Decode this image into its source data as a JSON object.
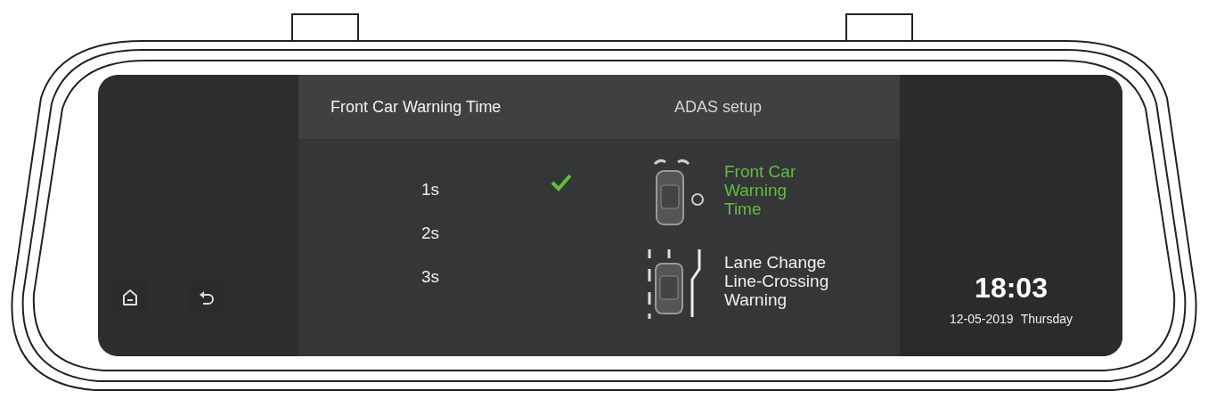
{
  "header": {
    "title": "Front Car Warning Time",
    "section": "ADAS setup"
  },
  "options": [
    {
      "label": "1s",
      "selected": true
    },
    {
      "label": "2s",
      "selected": false
    },
    {
      "label": "3s",
      "selected": false
    }
  ],
  "features": [
    {
      "kind": "front-car",
      "lines": [
        "Front Car",
        "Warning",
        "Time"
      ],
      "selected": true
    },
    {
      "kind": "lane",
      "lines": [
        "Lane Change",
        "Line-Crossing",
        "Warning"
      ],
      "selected": false
    }
  ],
  "clock": {
    "time": "18:03",
    "date": "12-05-2019",
    "day": "Thursday"
  }
}
